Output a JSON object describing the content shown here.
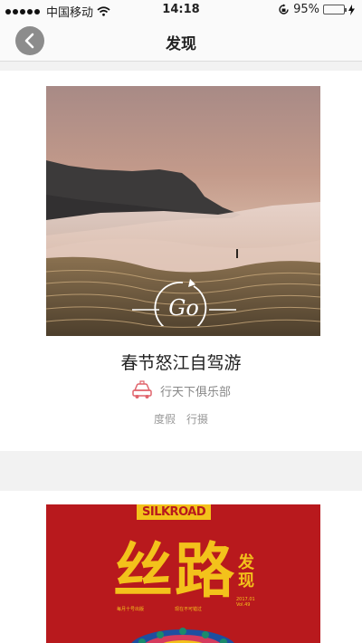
{
  "status_bar": {
    "carrier": "中国移动",
    "time": "14:18",
    "battery_pct": "95%",
    "battery_level": 0.95,
    "icons": [
      "signal-dots-icon",
      "wifi-icon",
      "orientation-lock-icon",
      "battery-icon",
      "charging-icon"
    ]
  },
  "nav": {
    "title": "发现",
    "back_icon": "chevron-left-icon"
  },
  "cards": [
    {
      "image_text": "Go",
      "title": "春节怒江自驾游",
      "club_icon": "car-icon",
      "club_name": "行天下俱乐部",
      "tags": [
        "度假",
        "行摄"
      ]
    },
    {
      "banner": "SILKROAD",
      "title": "丝路",
      "side_title_1": "发",
      "side_title_2": "现",
      "fine_print_1": "每月十号出版",
      "fine_print_2": "现在不可错过",
      "fine_print_3": "2017.01",
      "fine_print_4": "Vol.49"
    }
  ],
  "colors": {
    "accent_red": "#b8191d",
    "accent_yellow": "#f3c21b",
    "club_icon_red": "#e0636b"
  }
}
